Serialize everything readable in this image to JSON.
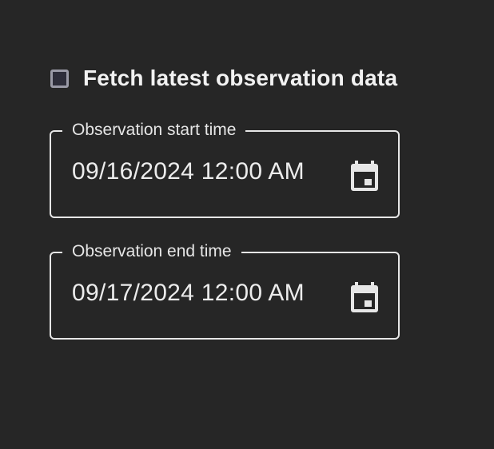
{
  "fetch_latest": {
    "label": "Fetch latest observation data",
    "checked": false
  },
  "start_time": {
    "label": "Observation start time",
    "value": "09/16/2024 12:00 AM",
    "icon": "calendar-icon"
  },
  "end_time": {
    "label": "Observation end time",
    "value": "09/17/2024 12:00 AM",
    "icon": "calendar-icon"
  },
  "colors": {
    "background": "#262626",
    "border": "#e6e6e6",
    "text": "#e9e9e9",
    "checkbox_border": "#9a9aa6"
  }
}
